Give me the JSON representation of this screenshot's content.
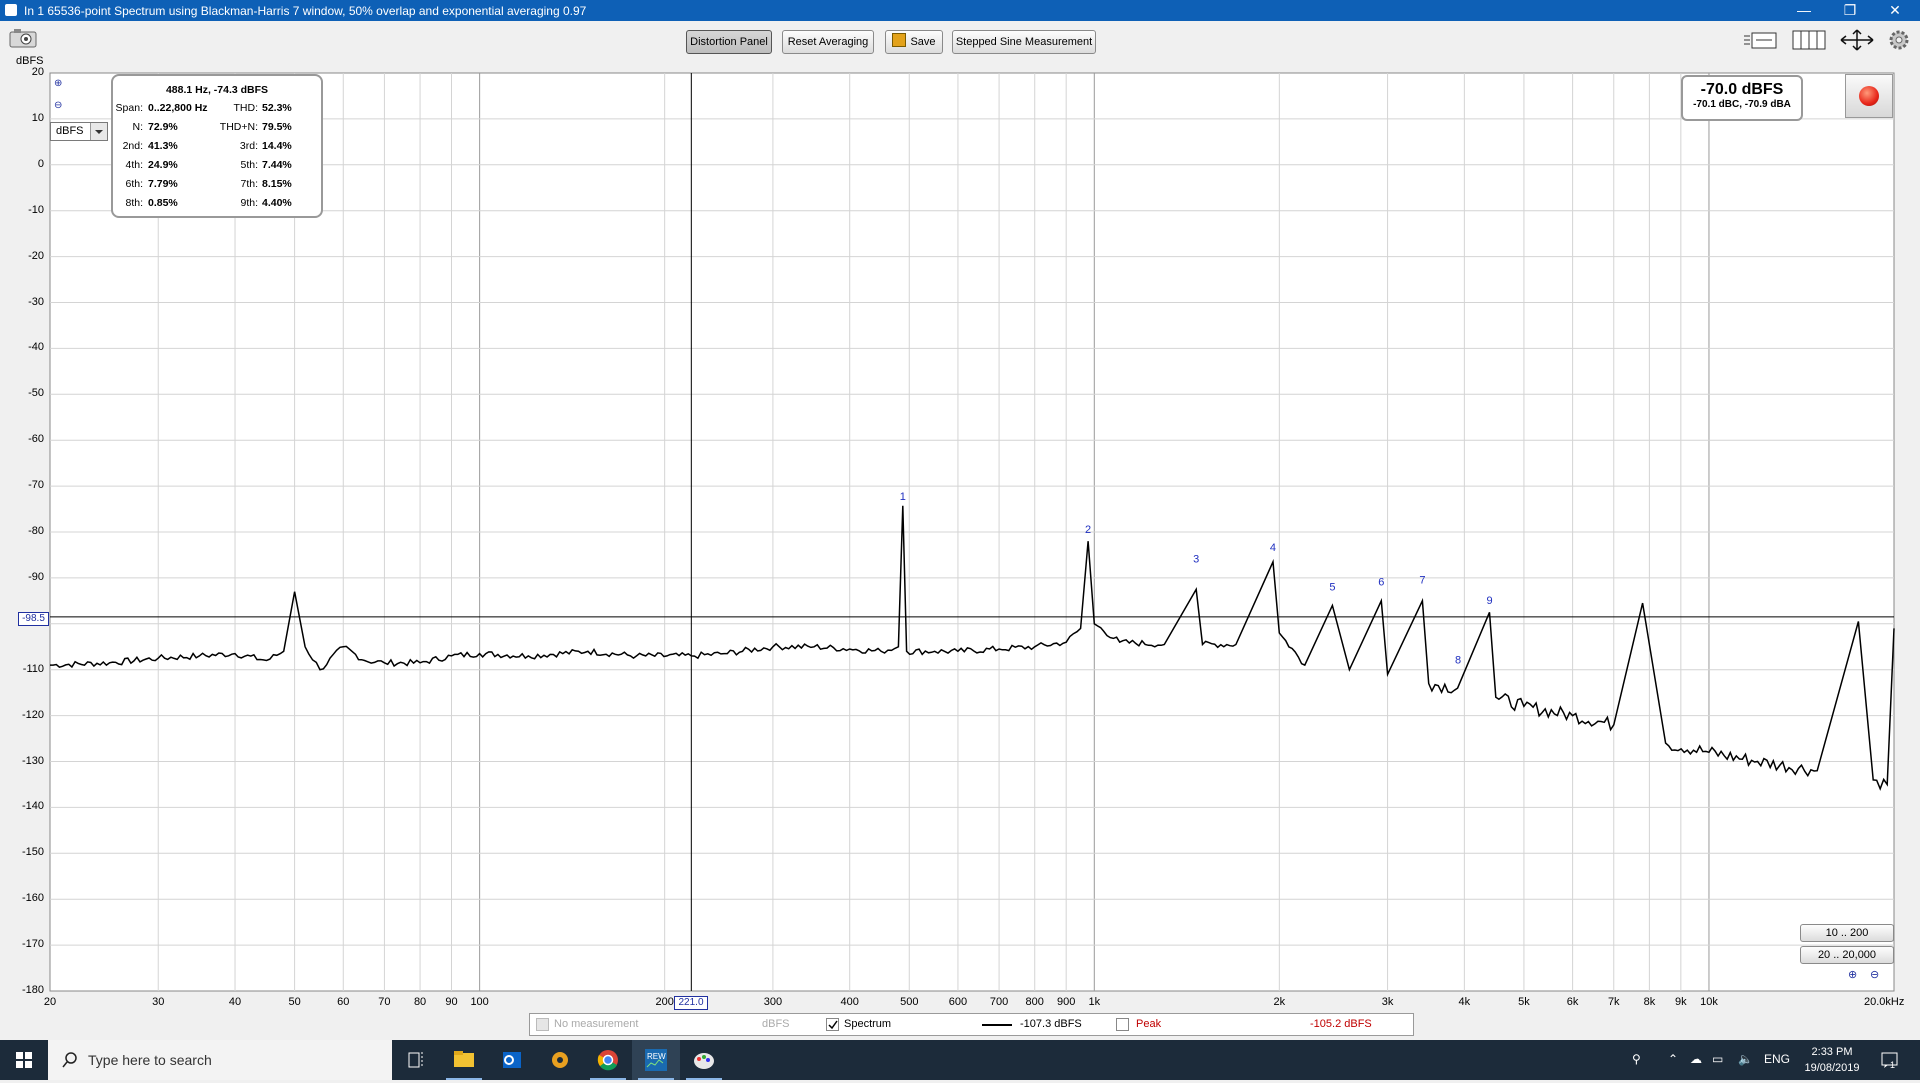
{
  "window": {
    "title": "In 1 65536-point Spectrum using Blackman-Harris 7 window, 50% overlap and exponential averaging 0.97",
    "controls": {
      "minimize": "—",
      "restore": "❐",
      "close": "✕"
    }
  },
  "toolbar": {
    "buttons": [
      "Distortion Panel",
      "Reset Averaging",
      "Save",
      "Stepped Sine Measurement"
    ],
    "active_button": "Distortion Panel",
    "icons": [
      "camera-icon",
      "zoom-fit-icon",
      "layout-icon",
      "pan-arrows-icon",
      "gear-icon"
    ]
  },
  "units": {
    "y_unit_label": "dBFS",
    "selector_value": "dBFS"
  },
  "distortion_panel": {
    "header": "488.1 Hz, -74.3 dBFS",
    "rows": [
      {
        "l1": "Span:",
        "v1": "0..22,800 Hz",
        "l2": "THD:",
        "v2": "52.3%"
      },
      {
        "l1": "N:",
        "v1": "72.9%",
        "l2": "THD+N:",
        "v2": "79.5%"
      },
      {
        "l1": "2nd:",
        "v1": "41.3%",
        "l2": "3rd:",
        "v2": "14.4%"
      },
      {
        "l1": "4th:",
        "v1": "24.9%",
        "l2": "5th:",
        "v2": "7.44%"
      },
      {
        "l1": "6th:",
        "v1": "7.79%",
        "l2": "7th:",
        "v2": "8.15%"
      },
      {
        "l1": "8th:",
        "v1": "0.85%",
        "l2": "9th:",
        "v2": "4.40%"
      }
    ]
  },
  "level_meter": {
    "main": "-70.0 dBFS",
    "sub": "-70.1 dBC, -70.9 dBA"
  },
  "cursor": {
    "y_value": "-98.5",
    "x_value": "221.0"
  },
  "range_buttons": [
    "10 .. 200",
    "20 .. 20,000"
  ],
  "legend": {
    "no_measurement": "No measurement",
    "no_measurement_unit": "dBFS",
    "spectrum_label": "Spectrum",
    "spectrum_checked": true,
    "spectrum_value": "-107.3 dBFS",
    "peak_label": "Peak",
    "peak_checked": false,
    "peak_value": "-105.2 dBFS"
  },
  "chart_data": {
    "type": "line",
    "title": "",
    "xlabel": "",
    "ylabel": "dBFS",
    "x_scale": "log",
    "xlim": [
      20,
      20000
    ],
    "ylim": [
      -180,
      20
    ],
    "grid": true,
    "x_ticks": [
      "20",
      "30",
      "40",
      "50",
      "60",
      "70",
      "80",
      "90",
      "100",
      "200",
      "300",
      "400",
      "500",
      "600",
      "700",
      "800",
      "900",
      "1k",
      "2k",
      "3k",
      "4k",
      "5k",
      "6k",
      "7k",
      "8k",
      "9k",
      "10k",
      "20.0kHz"
    ],
    "y_ticks": [
      "20",
      "10",
      "0",
      "-10",
      "-20",
      "-30",
      "-40",
      "-50",
      "-60",
      "-70",
      "-80",
      "-90",
      "-100",
      "-110",
      "-120",
      "-130",
      "-140",
      "-150",
      "-160",
      "-170",
      "-180"
    ],
    "series": [
      {
        "color": "#000000",
        "points": [
          [
            20,
            -109
          ],
          [
            25,
            -108.5
          ],
          [
            30,
            -107.5
          ],
          [
            35,
            -107
          ],
          [
            40,
            -106.5
          ],
          [
            45,
            -108
          ],
          [
            48,
            -106
          ],
          [
            50,
            -93
          ],
          [
            52,
            -105
          ],
          [
            55,
            -110
          ],
          [
            60,
            -105
          ],
          [
            65,
            -108
          ],
          [
            70,
            -108.5
          ],
          [
            80,
            -108.5
          ],
          [
            90,
            -107
          ],
          [
            100,
            -106.5
          ],
          [
            120,
            -107
          ],
          [
            150,
            -106
          ],
          [
            180,
            -107
          ],
          [
            221,
            -107
          ],
          [
            250,
            -106.5
          ],
          [
            300,
            -105
          ],
          [
            350,
            -105
          ],
          [
            400,
            -105.5
          ],
          [
            450,
            -106
          ],
          [
            480,
            -105
          ],
          [
            488,
            -74.3
          ],
          [
            495,
            -106
          ],
          [
            550,
            -106
          ],
          [
            600,
            -106
          ],
          [
            700,
            -105.5
          ],
          [
            800,
            -105
          ],
          [
            900,
            -104
          ],
          [
            950,
            -101
          ],
          [
            977,
            -82
          ],
          [
            1000,
            -100
          ],
          [
            1100,
            -104
          ],
          [
            1300,
            -104.5
          ],
          [
            1465,
            -92.5
          ],
          [
            1500,
            -104.5
          ],
          [
            1700,
            -104.5
          ],
          [
            1953,
            -86.5
          ],
          [
            2000,
            -102
          ],
          [
            2200,
            -109
          ],
          [
            2440,
            -96
          ],
          [
            2600,
            -110
          ],
          [
            2930,
            -95
          ],
          [
            3000,
            -111
          ],
          [
            3418,
            -95
          ],
          [
            3500,
            -113
          ],
          [
            3900,
            -114
          ],
          [
            4395,
            -97.5
          ],
          [
            4500,
            -116
          ],
          [
            5000,
            -118
          ],
          [
            6000,
            -120
          ],
          [
            7000,
            -122
          ],
          [
            7800,
            -95.5
          ],
          [
            8500,
            -126
          ],
          [
            10000,
            -128
          ],
          [
            12000,
            -130
          ],
          [
            15000,
            -132
          ],
          [
            17500,
            -99.5
          ],
          [
            18500,
            -134
          ],
          [
            19500,
            -135
          ],
          [
            20000,
            -101
          ]
        ]
      }
    ],
    "harmonic_markers": [
      {
        "label": "1",
        "x": 488,
        "y": -74.3
      },
      {
        "label": "2",
        "x": 977,
        "y": -81.5
      },
      {
        "label": "3",
        "x": 1465,
        "y": -88
      },
      {
        "label": "4",
        "x": 1953,
        "y": -85.5
      },
      {
        "label": "5",
        "x": 2440,
        "y": -94
      },
      {
        "label": "6",
        "x": 2930,
        "y": -93
      },
      {
        "label": "7",
        "x": 3418,
        "y": -92.5
      },
      {
        "label": "8",
        "x": 3906,
        "y": -110
      },
      {
        "label": "9",
        "x": 4395,
        "y": -97
      }
    ]
  },
  "taskbar": {
    "search_placeholder": "Type here to search",
    "apps": [
      "task-view-icon",
      "file-explorer-icon",
      "outlook-icon",
      "app-icon",
      "chrome-icon",
      "rew-icon",
      "paint-icon"
    ],
    "language": "ENG",
    "time": "2:33 PM",
    "date": "19/08/2019",
    "notification_count": "1"
  }
}
